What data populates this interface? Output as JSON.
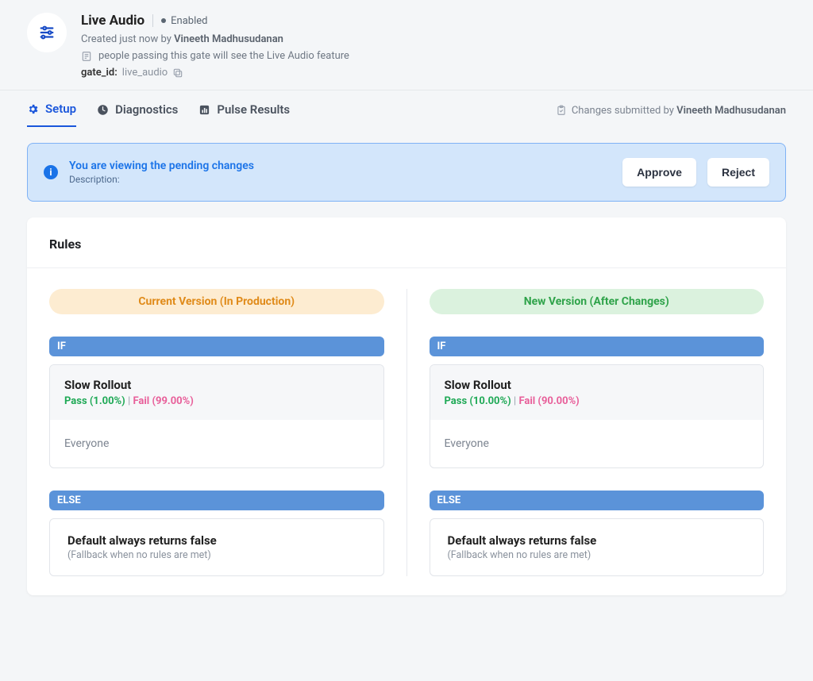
{
  "header": {
    "title": "Live Audio",
    "status": "Enabled",
    "created_prefix": "Created just now by ",
    "created_by": "Vineeth Madhusudanan",
    "note": "people passing this gate will see the Live Audio feature",
    "gate_id_label": "gate_id:",
    "gate_id": "live_audio"
  },
  "tabs": {
    "setup": "Setup",
    "diagnostics": "Diagnostics",
    "pulse": "Pulse Results"
  },
  "changes_by": {
    "prefix": "Changes submitted by ",
    "user": "Vineeth Madhusudanan"
  },
  "banner": {
    "title": "You are viewing the pending changes",
    "description": "Description:",
    "approve": "Approve",
    "reject": "Reject"
  },
  "rules": {
    "title": "Rules",
    "current_label": "Current Version (In Production)",
    "new_label": "New Version (After Changes)",
    "if_tag": "IF",
    "else_tag": "ELSE",
    "rule_name": "Slow Rollout",
    "everyone": "Everyone",
    "default_title": "Default always returns false",
    "default_sub": "(Fallback when no rules are met)",
    "current": {
      "pass": "Pass (1.00%)",
      "fail": "Fail (99.00%)"
    },
    "new": {
      "pass": "Pass (10.00%)",
      "fail": "Fail (90.00%)"
    },
    "sep": " | "
  }
}
